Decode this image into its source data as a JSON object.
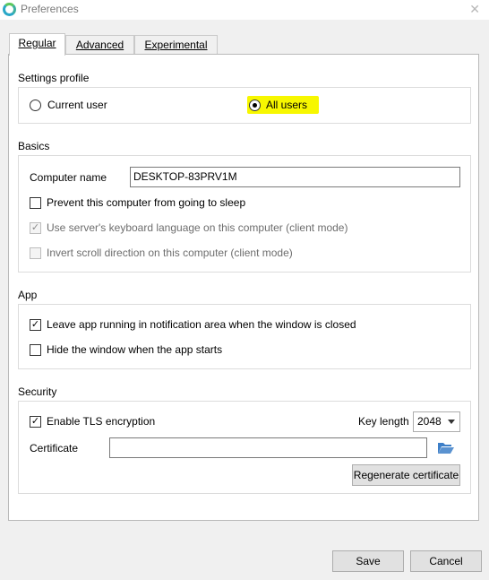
{
  "window": {
    "title": "Preferences",
    "close_glyph": "✕"
  },
  "tabs": [
    {
      "label": "Regular",
      "active": true
    },
    {
      "label": "Advanced",
      "active": false
    },
    {
      "label": "Experimental",
      "active": false
    }
  ],
  "settings_profile": {
    "title": "Settings profile",
    "options": [
      {
        "label": "Current user",
        "selected": false
      },
      {
        "label": "All users",
        "selected": true
      }
    ],
    "highlight_color": "#f7f700"
  },
  "basics": {
    "title": "Basics",
    "computer_name_label": "Computer name",
    "computer_name_value": "DESKTOP-83PRV1M",
    "prevent_sleep": {
      "label": "Prevent this computer from going to sleep",
      "checked": false
    },
    "keyboard_language": {
      "label": "Use server's keyboard language on this computer (client mode)",
      "checked": true,
      "enabled": false
    },
    "invert_scroll": {
      "label": "Invert scroll direction on this computer (client mode)",
      "checked": false,
      "enabled": false
    }
  },
  "app": {
    "title": "App",
    "leave_running": {
      "label": "Leave app running in notification area when the window is closed",
      "checked": true
    },
    "hide_window": {
      "label": "Hide the window when the app starts",
      "checked": false
    }
  },
  "security": {
    "title": "Security",
    "enable_tls": {
      "label": "Enable TLS encryption",
      "checked": true
    },
    "key_length_label": "Key length",
    "key_length_value": "2048",
    "certificate_label": "Certificate",
    "certificate_value": "",
    "regenerate_label": "Regenerate certificate"
  },
  "footer": {
    "save_label": "Save",
    "cancel_label": "Cancel"
  },
  "icons": {
    "app": "app-logo-icon",
    "folder": "folder-open-icon",
    "check": "✓"
  },
  "colors": {
    "folder": "#3d7fc8",
    "accent": "#2aa8c8"
  }
}
